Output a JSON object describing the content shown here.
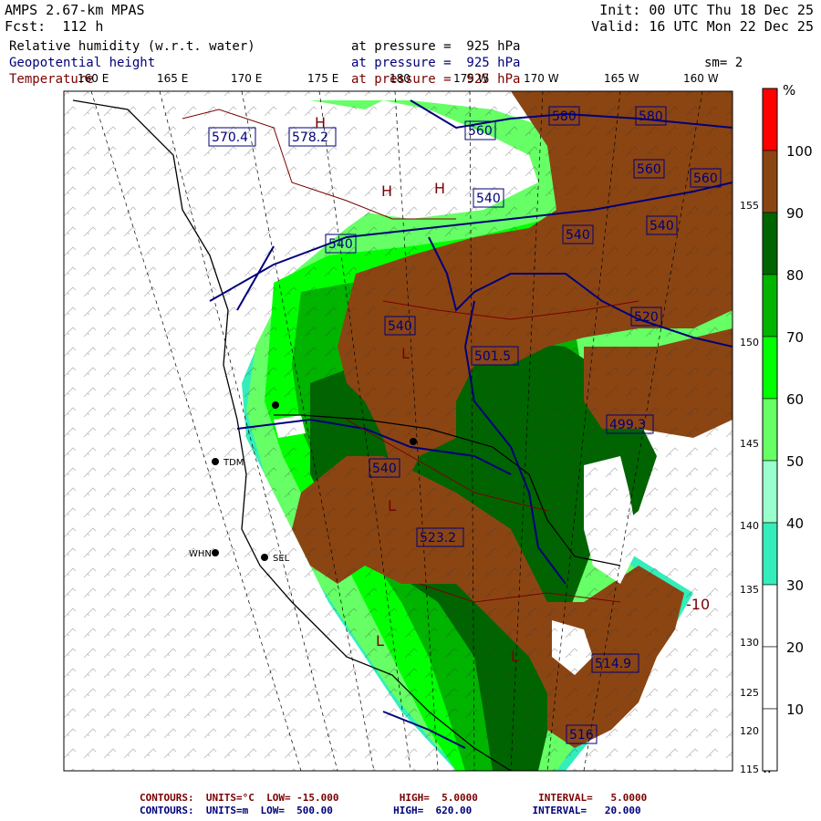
{
  "header": {
    "model": "AMPS 2.67-km MPAS",
    "fcst": "Fcst:  112 h",
    "init": "Init: 00 UTC Thu 18 Dec 25",
    "valid": "Valid: 16 UTC Mon 22 Dec 25",
    "fields": [
      {
        "name": "Relative humidity (w.r.t. water)",
        "level": "at pressure =  925 hPa"
      },
      {
        "name": "Geopotential height",
        "level": "at pressure =  925 hPa"
      },
      {
        "name": "Temperature",
        "level": "at pressure =  925 hPa"
      }
    ],
    "smoothing": "sm= 2"
  },
  "colors": {
    "rh_100": "#ff0000",
    "rh_90": "#8b4513",
    "rh_80": "#006400",
    "rh_70": "#00b400",
    "rh_60": "#00ff00",
    "rh_50": "#66ff66",
    "rh_40": "#99ffcc",
    "rh_30": "#33eebb",
    "rh_below": "#ffffff",
    "height_contour": "#00007a",
    "temp_contour": "#7a0000"
  },
  "colorbar": {
    "unit": "%",
    "labels": [
      "100",
      "90",
      "80",
      "70",
      "60",
      "50",
      "40",
      "30",
      "20",
      "10"
    ]
  },
  "longitudes": [
    "160 E",
    "165 E",
    "170 E",
    "175 E",
    "180",
    "175 W",
    "170 W",
    "165 W",
    "160 W"
  ],
  "latitudes": [
    "155 W",
    "150 W",
    "145 W",
    "140 W",
    "135 W",
    "130 W",
    "125 W",
    "120 W",
    "115 W"
  ],
  "stations": [
    "TDM",
    "WHN",
    "SEL"
  ],
  "height_labels": [
    "580",
    "580",
    "560",
    "560",
    "560",
    "540",
    "540",
    "540",
    "540",
    "540",
    "540",
    "520",
    "501.5",
    "499.3",
    "523.2",
    "578.2",
    "570.4",
    "514.9",
    "516"
  ],
  "temp_labels": [
    "H",
    "H",
    "H",
    "L",
    "L",
    "L",
    "L",
    "-10"
  ],
  "footer": {
    "temp_contours": "CONTOURS:  UNITS=°C  LOW= -15.000          HIGH=  5.0000          INTERVAL=   5.0000",
    "height_contours": "CONTOURS:  UNITS=m  LOW=  500.00          HIGH=  620.00          INTERVAL=   20.000"
  }
}
